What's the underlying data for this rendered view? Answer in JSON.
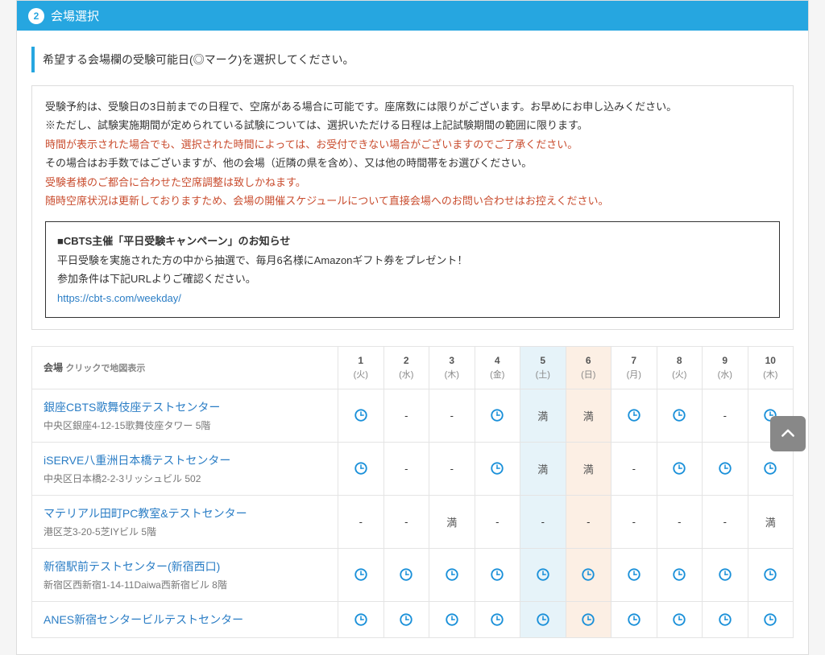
{
  "step": {
    "num": "2",
    "title": "会場選択"
  },
  "instruction": "希望する会場欄の受験可能日(◎マーク)を選択してください。",
  "notice": {
    "p1": "受験予約は、受験日の3日前までの日程で、空席がある場合に可能です。座席数には限りがございます。お早めにお申し込みください。",
    "p2": "※ただし、試験実施期間が定められている試験については、選択いただける日程は上記試験期間の範囲に限ります。",
    "warn1": "時間が表示された場合でも、選択された時間によっては、お受付できない場合がございますのでご了承ください。",
    "p3": "その場合はお手数ではございますが、他の会場（近隣の県を含め）、又は他の時間帯をお選びください。",
    "warn2a": "受験者様のご都合に合わせた空席調整は致しかねます。",
    "warn2b": "随時空席状況は更新しておりますため、会場の開催スケジュールについて直接会場へのお問い合わせはお控えください。"
  },
  "campaign": {
    "title": "■CBTS主催「平日受験キャンペーン」のお知らせ",
    "body": "平日受験を実施された方の中から抽選で、毎月6名様にAmazonギフト券をプレゼント！",
    "cond": "参加条件は下記URLよりご確認ください。",
    "url": "https://cbt-s.com/weekday/"
  },
  "table": {
    "venueHead": "会場",
    "venueSub": "クリックで地図表示",
    "full_label": "満",
    "days": [
      {
        "d": "1",
        "w": "(火)",
        "cls": ""
      },
      {
        "d": "2",
        "w": "(水)",
        "cls": ""
      },
      {
        "d": "3",
        "w": "(木)",
        "cls": ""
      },
      {
        "d": "4",
        "w": "(金)",
        "cls": ""
      },
      {
        "d": "5",
        "w": "(土)",
        "cls": "col-sat"
      },
      {
        "d": "6",
        "w": "(日)",
        "cls": "col-sun"
      },
      {
        "d": "7",
        "w": "(月)",
        "cls": ""
      },
      {
        "d": "8",
        "w": "(火)",
        "cls": ""
      },
      {
        "d": "9",
        "w": "(水)",
        "cls": ""
      },
      {
        "d": "10",
        "w": "(木)",
        "cls": ""
      }
    ],
    "venues": [
      {
        "name": "銀座CBTS歌舞伎座テストセンター",
        "addr": "中央区銀座4-12-15歌舞伎座タワー 5階",
        "slots": [
          "o",
          "-",
          "-",
          "o",
          "full",
          "full",
          "o",
          "o",
          "-",
          "o"
        ]
      },
      {
        "name": "iSERVE八重洲日本橋テストセンター",
        "addr": "中央区日本橋2-2-3リッシュビル 502",
        "slots": [
          "o",
          "-",
          "-",
          "o",
          "full",
          "full",
          "-",
          "o",
          "o",
          "o"
        ]
      },
      {
        "name": "マテリアル田町PC教室&テストセンター",
        "addr": "港区芝3-20-5芝IYビル 5階",
        "slots": [
          "-",
          "-",
          "full",
          "-",
          "-",
          "-",
          "-",
          "-",
          "-",
          "full"
        ]
      },
      {
        "name": "新宿駅前テストセンター(新宿西口)",
        "addr": "新宿区西新宿1-14-11Daiwa西新宿ビル 8階",
        "slots": [
          "o",
          "o",
          "o",
          "o",
          "o",
          "o",
          "o",
          "o",
          "o",
          "o"
        ]
      },
      {
        "name": "ANES新宿センタービルテストセンター",
        "addr": "",
        "slots": [
          "o",
          "o",
          "o",
          "o",
          "o",
          "o",
          "o",
          "o",
          "o",
          "o"
        ]
      }
    ]
  }
}
